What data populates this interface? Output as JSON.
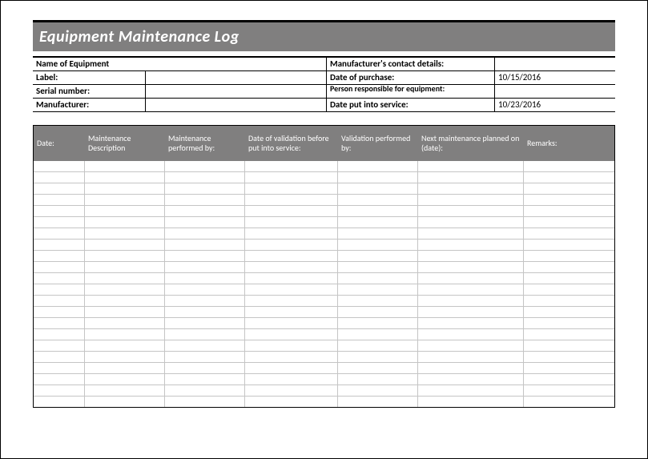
{
  "title": "Equipment Maintenance Log",
  "info": {
    "name_label": "Name of Equipment",
    "name_value": "",
    "mfr_contact_label": "Manufacturer's contact details:",
    "mfr_contact_value": "",
    "label_label": "Label:",
    "label_value": "",
    "purchase_label": "Date of purchase:",
    "purchase_value": "10/15/2016",
    "serial_label": "Serial number:",
    "serial_value": "",
    "responsible_label": "Person responsible for equipment:",
    "responsible_value": "",
    "mfr_label": "Manufacturer:",
    "mfr_value": "",
    "service_label": "Date put into service:",
    "service_value": "10/23/2016"
  },
  "log": {
    "headers": {
      "date": "Date:",
      "description": "Maintenance Description",
      "performed_by": "Maintenance performed by:",
      "validation_date": "Date of validation before put into service:",
      "validated_by": "Validation performed by:",
      "next": "Next maintenance planned on (date):",
      "remarks": "Remarks:"
    },
    "row_count": 22
  }
}
